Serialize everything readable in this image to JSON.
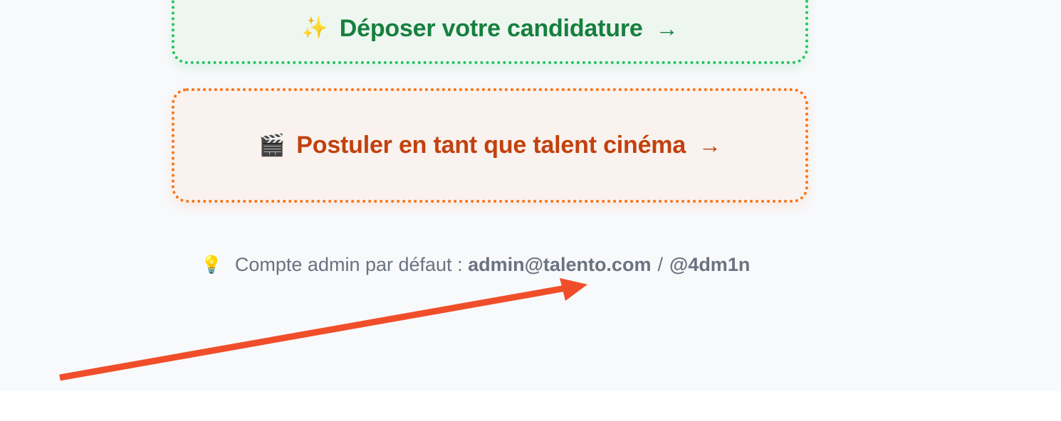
{
  "actions": {
    "apply_button": {
      "icon": "sparkles-icon",
      "label": "Déposer votre candidature",
      "arrow": "→"
    },
    "cinema_button": {
      "icon": "clapperboard-icon",
      "label": "Postuler en tant que talent cinéma",
      "arrow": "→"
    }
  },
  "hint": {
    "icon": "lightbulb-icon",
    "prefix": "Compte admin par défaut :",
    "email": "admin@talento.com",
    "separator": "/",
    "password": "@4dm1n"
  },
  "colors": {
    "page_background": "#f8f9fb",
    "green_accent": "#22c55e",
    "green_text": "#15803d",
    "orange_accent": "#f97316",
    "orange_text": "#c2410c",
    "annotation_arrow": "#f04e2a"
  }
}
